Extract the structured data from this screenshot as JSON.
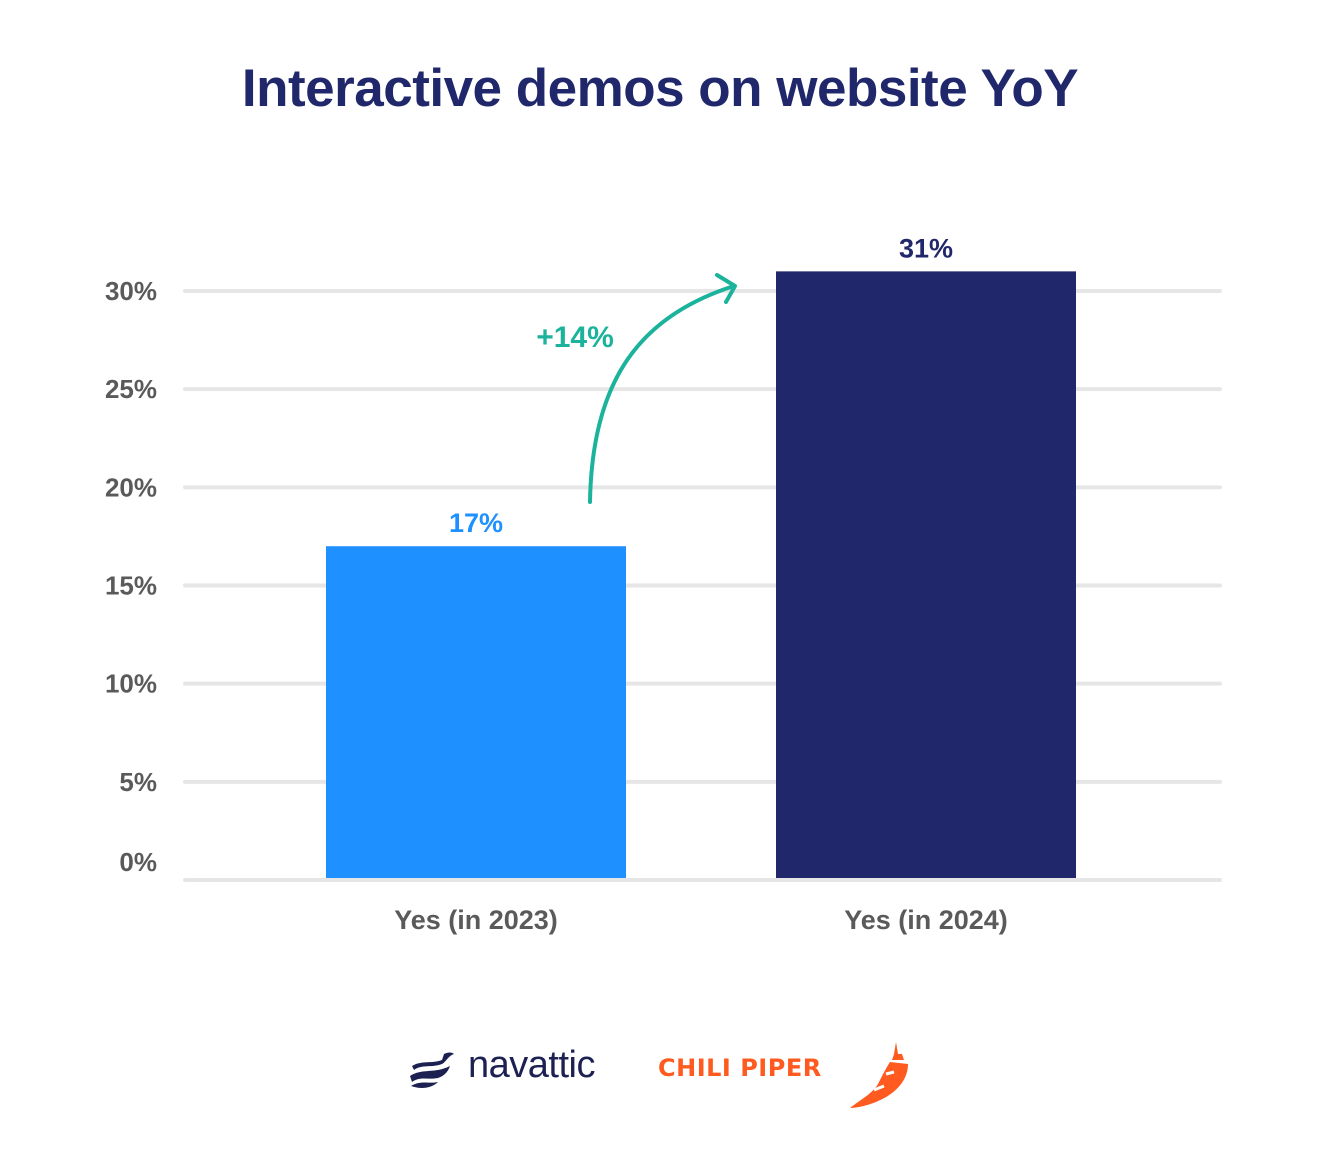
{
  "chart_data": {
    "type": "bar",
    "title": "Interactive demos on website YoY",
    "xlabel": "",
    "ylabel": "",
    "categories": [
      "Yes (in 2023)",
      "Yes (in 2024)"
    ],
    "values": [
      17,
      31
    ],
    "value_labels": [
      "17%",
      "31%"
    ],
    "bar_colors": [
      "#1E90FF",
      "#20286B"
    ],
    "label_colors": [
      "#1E90FF",
      "#20286B"
    ],
    "ylim": [
      0,
      30
    ],
    "yticks": [
      0,
      5,
      10,
      15,
      20,
      25,
      30
    ],
    "ytick_labels": [
      "0%",
      "5%",
      "10%",
      "15%",
      "20%",
      "25%",
      "30%"
    ],
    "grid": true,
    "legend": "none",
    "annotations": [
      {
        "text": "+14%",
        "type": "curved-arrow",
        "from": "Yes (in 2023)",
        "to": "Yes (in 2024)",
        "color": "#1BB39B"
      }
    ]
  },
  "colors": {
    "title": "#20286B",
    "grid": "#E6E6E6",
    "tick_text": "#5A5A5A",
    "annotation": "#1BB39B",
    "navattic": "#1C2152",
    "chili_piper": "#FF5A1F"
  },
  "logos": {
    "navattic": "navattic",
    "chili_piper": "CHILI PIPER"
  }
}
